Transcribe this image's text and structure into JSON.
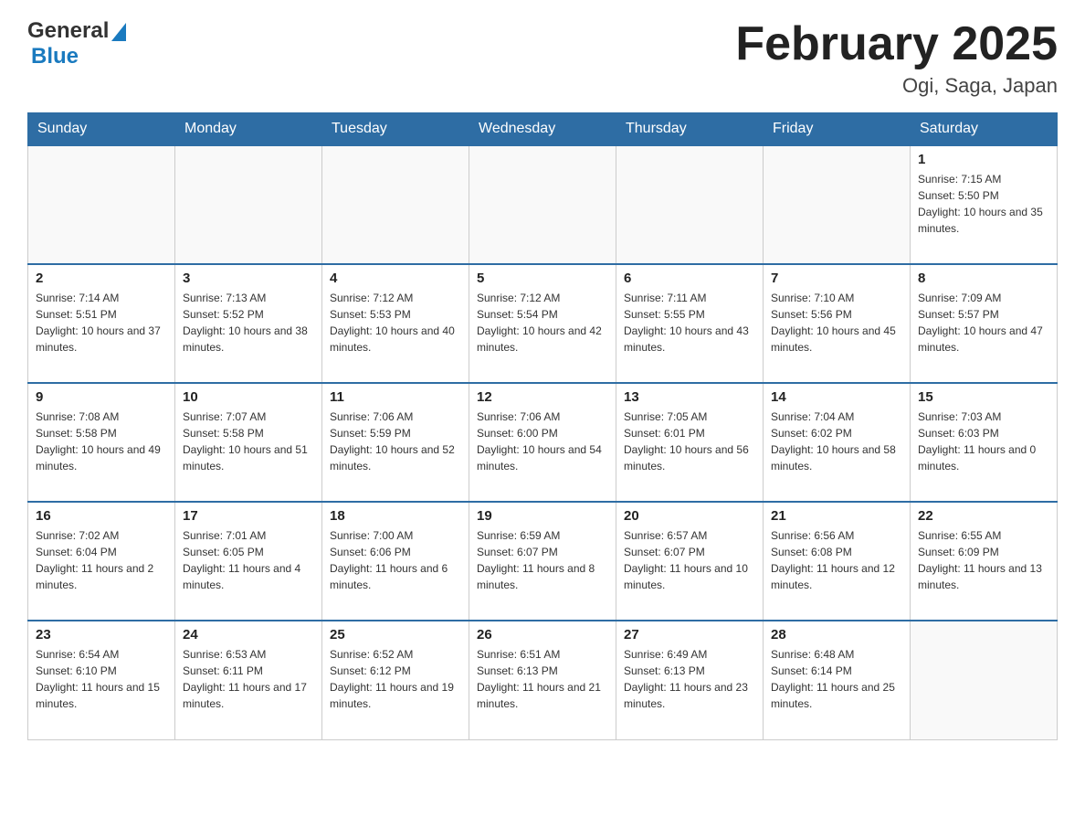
{
  "header": {
    "logo_general": "General",
    "logo_blue": "Blue",
    "title": "February 2025",
    "subtitle": "Ogi, Saga, Japan"
  },
  "days_of_week": [
    "Sunday",
    "Monday",
    "Tuesday",
    "Wednesday",
    "Thursday",
    "Friday",
    "Saturday"
  ],
  "weeks": [
    [
      {
        "day": "",
        "sunrise": "",
        "sunset": "",
        "daylight": "",
        "empty": true
      },
      {
        "day": "",
        "sunrise": "",
        "sunset": "",
        "daylight": "",
        "empty": true
      },
      {
        "day": "",
        "sunrise": "",
        "sunset": "",
        "daylight": "",
        "empty": true
      },
      {
        "day": "",
        "sunrise": "",
        "sunset": "",
        "daylight": "",
        "empty": true
      },
      {
        "day": "",
        "sunrise": "",
        "sunset": "",
        "daylight": "",
        "empty": true
      },
      {
        "day": "",
        "sunrise": "",
        "sunset": "",
        "daylight": "",
        "empty": true
      },
      {
        "day": "1",
        "sunrise": "Sunrise: 7:15 AM",
        "sunset": "Sunset: 5:50 PM",
        "daylight": "Daylight: 10 hours and 35 minutes.",
        "empty": false
      }
    ],
    [
      {
        "day": "2",
        "sunrise": "Sunrise: 7:14 AM",
        "sunset": "Sunset: 5:51 PM",
        "daylight": "Daylight: 10 hours and 37 minutes.",
        "empty": false
      },
      {
        "day": "3",
        "sunrise": "Sunrise: 7:13 AM",
        "sunset": "Sunset: 5:52 PM",
        "daylight": "Daylight: 10 hours and 38 minutes.",
        "empty": false
      },
      {
        "day": "4",
        "sunrise": "Sunrise: 7:12 AM",
        "sunset": "Sunset: 5:53 PM",
        "daylight": "Daylight: 10 hours and 40 minutes.",
        "empty": false
      },
      {
        "day": "5",
        "sunrise": "Sunrise: 7:12 AM",
        "sunset": "Sunset: 5:54 PM",
        "daylight": "Daylight: 10 hours and 42 minutes.",
        "empty": false
      },
      {
        "day": "6",
        "sunrise": "Sunrise: 7:11 AM",
        "sunset": "Sunset: 5:55 PM",
        "daylight": "Daylight: 10 hours and 43 minutes.",
        "empty": false
      },
      {
        "day": "7",
        "sunrise": "Sunrise: 7:10 AM",
        "sunset": "Sunset: 5:56 PM",
        "daylight": "Daylight: 10 hours and 45 minutes.",
        "empty": false
      },
      {
        "day": "8",
        "sunrise": "Sunrise: 7:09 AM",
        "sunset": "Sunset: 5:57 PM",
        "daylight": "Daylight: 10 hours and 47 minutes.",
        "empty": false
      }
    ],
    [
      {
        "day": "9",
        "sunrise": "Sunrise: 7:08 AM",
        "sunset": "Sunset: 5:58 PM",
        "daylight": "Daylight: 10 hours and 49 minutes.",
        "empty": false
      },
      {
        "day": "10",
        "sunrise": "Sunrise: 7:07 AM",
        "sunset": "Sunset: 5:58 PM",
        "daylight": "Daylight: 10 hours and 51 minutes.",
        "empty": false
      },
      {
        "day": "11",
        "sunrise": "Sunrise: 7:06 AM",
        "sunset": "Sunset: 5:59 PM",
        "daylight": "Daylight: 10 hours and 52 minutes.",
        "empty": false
      },
      {
        "day": "12",
        "sunrise": "Sunrise: 7:06 AM",
        "sunset": "Sunset: 6:00 PM",
        "daylight": "Daylight: 10 hours and 54 minutes.",
        "empty": false
      },
      {
        "day": "13",
        "sunrise": "Sunrise: 7:05 AM",
        "sunset": "Sunset: 6:01 PM",
        "daylight": "Daylight: 10 hours and 56 minutes.",
        "empty": false
      },
      {
        "day": "14",
        "sunrise": "Sunrise: 7:04 AM",
        "sunset": "Sunset: 6:02 PM",
        "daylight": "Daylight: 10 hours and 58 minutes.",
        "empty": false
      },
      {
        "day": "15",
        "sunrise": "Sunrise: 7:03 AM",
        "sunset": "Sunset: 6:03 PM",
        "daylight": "Daylight: 11 hours and 0 minutes.",
        "empty": false
      }
    ],
    [
      {
        "day": "16",
        "sunrise": "Sunrise: 7:02 AM",
        "sunset": "Sunset: 6:04 PM",
        "daylight": "Daylight: 11 hours and 2 minutes.",
        "empty": false
      },
      {
        "day": "17",
        "sunrise": "Sunrise: 7:01 AM",
        "sunset": "Sunset: 6:05 PM",
        "daylight": "Daylight: 11 hours and 4 minutes.",
        "empty": false
      },
      {
        "day": "18",
        "sunrise": "Sunrise: 7:00 AM",
        "sunset": "Sunset: 6:06 PM",
        "daylight": "Daylight: 11 hours and 6 minutes.",
        "empty": false
      },
      {
        "day": "19",
        "sunrise": "Sunrise: 6:59 AM",
        "sunset": "Sunset: 6:07 PM",
        "daylight": "Daylight: 11 hours and 8 minutes.",
        "empty": false
      },
      {
        "day": "20",
        "sunrise": "Sunrise: 6:57 AM",
        "sunset": "Sunset: 6:07 PM",
        "daylight": "Daylight: 11 hours and 10 minutes.",
        "empty": false
      },
      {
        "day": "21",
        "sunrise": "Sunrise: 6:56 AM",
        "sunset": "Sunset: 6:08 PM",
        "daylight": "Daylight: 11 hours and 12 minutes.",
        "empty": false
      },
      {
        "day": "22",
        "sunrise": "Sunrise: 6:55 AM",
        "sunset": "Sunset: 6:09 PM",
        "daylight": "Daylight: 11 hours and 13 minutes.",
        "empty": false
      }
    ],
    [
      {
        "day": "23",
        "sunrise": "Sunrise: 6:54 AM",
        "sunset": "Sunset: 6:10 PM",
        "daylight": "Daylight: 11 hours and 15 minutes.",
        "empty": false
      },
      {
        "day": "24",
        "sunrise": "Sunrise: 6:53 AM",
        "sunset": "Sunset: 6:11 PM",
        "daylight": "Daylight: 11 hours and 17 minutes.",
        "empty": false
      },
      {
        "day": "25",
        "sunrise": "Sunrise: 6:52 AM",
        "sunset": "Sunset: 6:12 PM",
        "daylight": "Daylight: 11 hours and 19 minutes.",
        "empty": false
      },
      {
        "day": "26",
        "sunrise": "Sunrise: 6:51 AM",
        "sunset": "Sunset: 6:13 PM",
        "daylight": "Daylight: 11 hours and 21 minutes.",
        "empty": false
      },
      {
        "day": "27",
        "sunrise": "Sunrise: 6:49 AM",
        "sunset": "Sunset: 6:13 PM",
        "daylight": "Daylight: 11 hours and 23 minutes.",
        "empty": false
      },
      {
        "day": "28",
        "sunrise": "Sunrise: 6:48 AM",
        "sunset": "Sunset: 6:14 PM",
        "daylight": "Daylight: 11 hours and 25 minutes.",
        "empty": false
      },
      {
        "day": "",
        "sunrise": "",
        "sunset": "",
        "daylight": "",
        "empty": true
      }
    ]
  ]
}
